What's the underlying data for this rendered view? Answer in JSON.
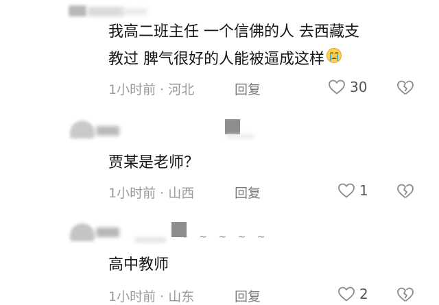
{
  "comments": [
    {
      "text_line1": "我高二班主任  一个信佛的人 去西藏支",
      "text_line2": "教过 脾气很好的人能被逼成这样",
      "time": "1小时前",
      "dot": "·",
      "location": "河北",
      "reply": "回复",
      "likes": "30",
      "emoji": "crying-face-icon"
    },
    {
      "text_line1": "贾某是老师？",
      "time": "1小时前",
      "dot": "·",
      "location": "山西",
      "reply": "回复",
      "likes": "1"
    },
    {
      "text_line1": "高中教师",
      "time": "1小时前",
      "dot": "·",
      "location": "山东",
      "reply": "回复",
      "likes": "2",
      "username_suffix": "~ ~ ~ ~ ~"
    }
  ],
  "colors": {
    "text": "#161616",
    "meta": "#9a9a9a",
    "icon": "#8a8a8a"
  }
}
